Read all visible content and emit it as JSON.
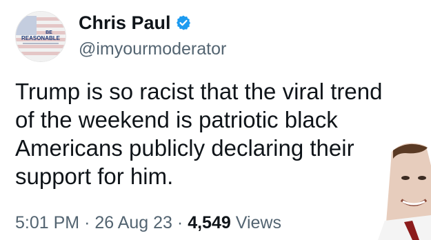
{
  "author": {
    "display_name": "Chris Paul",
    "handle": "@imyourmoderator",
    "avatar_text": "BE REASONABLE",
    "verified_color": "#1d9bf0"
  },
  "tweet": {
    "lines": [
      "Trump is so racist that the viral trend",
      "of the weekend is patriotic black",
      "Americans publicly declaring their",
      "support for him."
    ]
  },
  "meta": {
    "time": "5:01 PM",
    "separator": "·",
    "date": "26 Aug 23",
    "views_count": "4,549",
    "views_label": "Views"
  },
  "icons": {
    "verified": "verified-badge-icon"
  }
}
